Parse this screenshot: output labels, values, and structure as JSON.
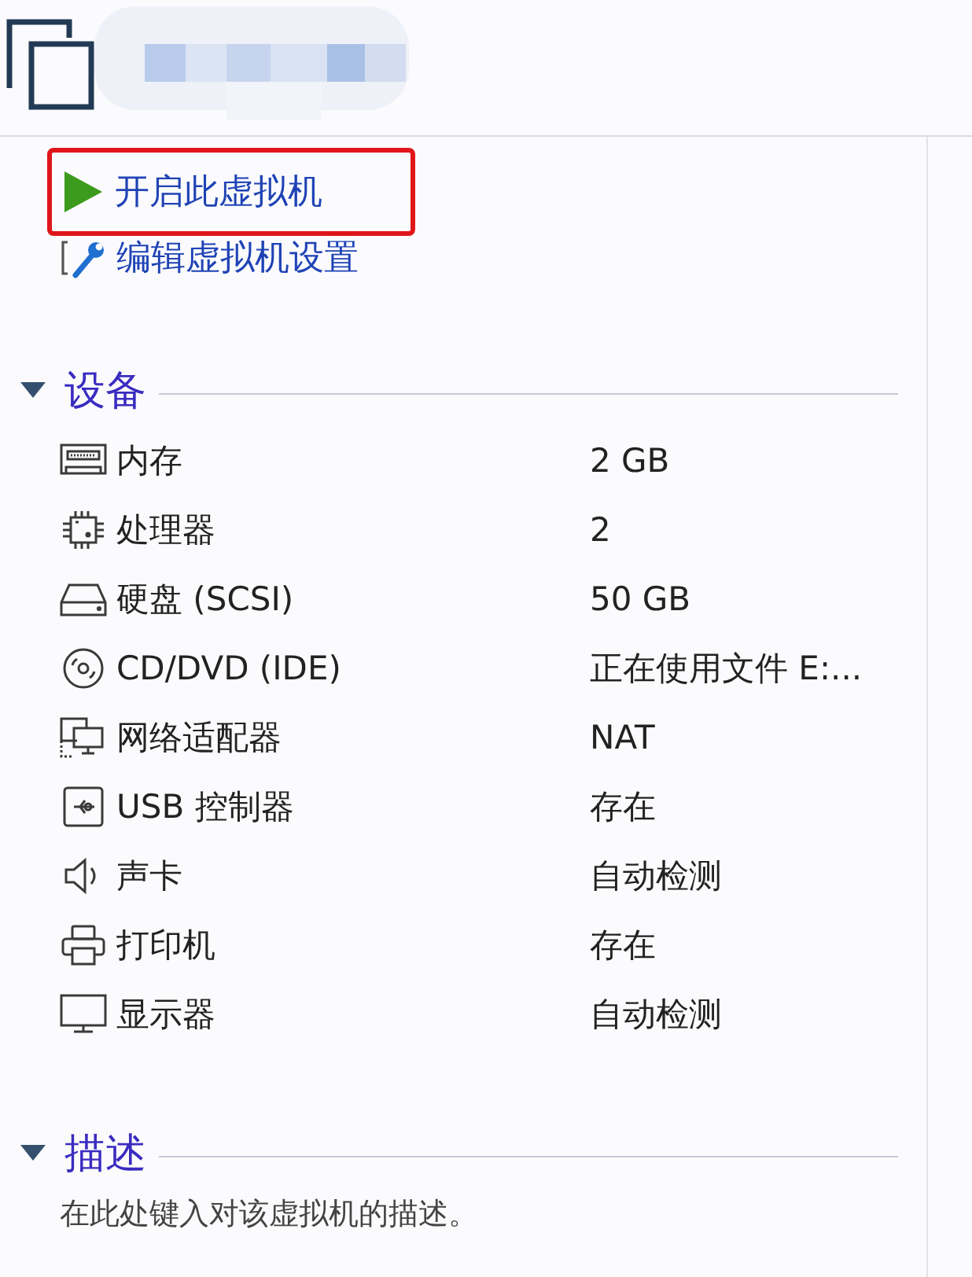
{
  "actions": [
    {
      "kind": "start",
      "label": "开启此虚拟机",
      "highlighted": true
    },
    {
      "kind": "edit",
      "label": "编辑虚拟机设置",
      "highlighted": false
    }
  ],
  "devices_section": {
    "title": "设备",
    "expanded": true,
    "rows": [
      {
        "kind": "memory",
        "name": "内存",
        "value": "2 GB"
      },
      {
        "kind": "processor",
        "name": "处理器",
        "value": "2"
      },
      {
        "kind": "hard_disk",
        "name": "硬盘 (SCSI)",
        "value": "50 GB"
      },
      {
        "kind": "cd_dvd",
        "name": "CD/DVD (IDE)",
        "value": "正在使用文件 E:..."
      },
      {
        "kind": "network",
        "name": "网络适配器",
        "value": "NAT"
      },
      {
        "kind": "usb",
        "name": "USB 控制器",
        "value": "存在"
      },
      {
        "kind": "sound",
        "name": "声卡",
        "value": "自动检测"
      },
      {
        "kind": "printer",
        "name": "打印机",
        "value": "存在"
      },
      {
        "kind": "display",
        "name": "显示器",
        "value": "自动检测"
      }
    ]
  },
  "description_section": {
    "title": "描述",
    "expanded": true,
    "text": "在此处键入对该虚拟机的描述。"
  }
}
